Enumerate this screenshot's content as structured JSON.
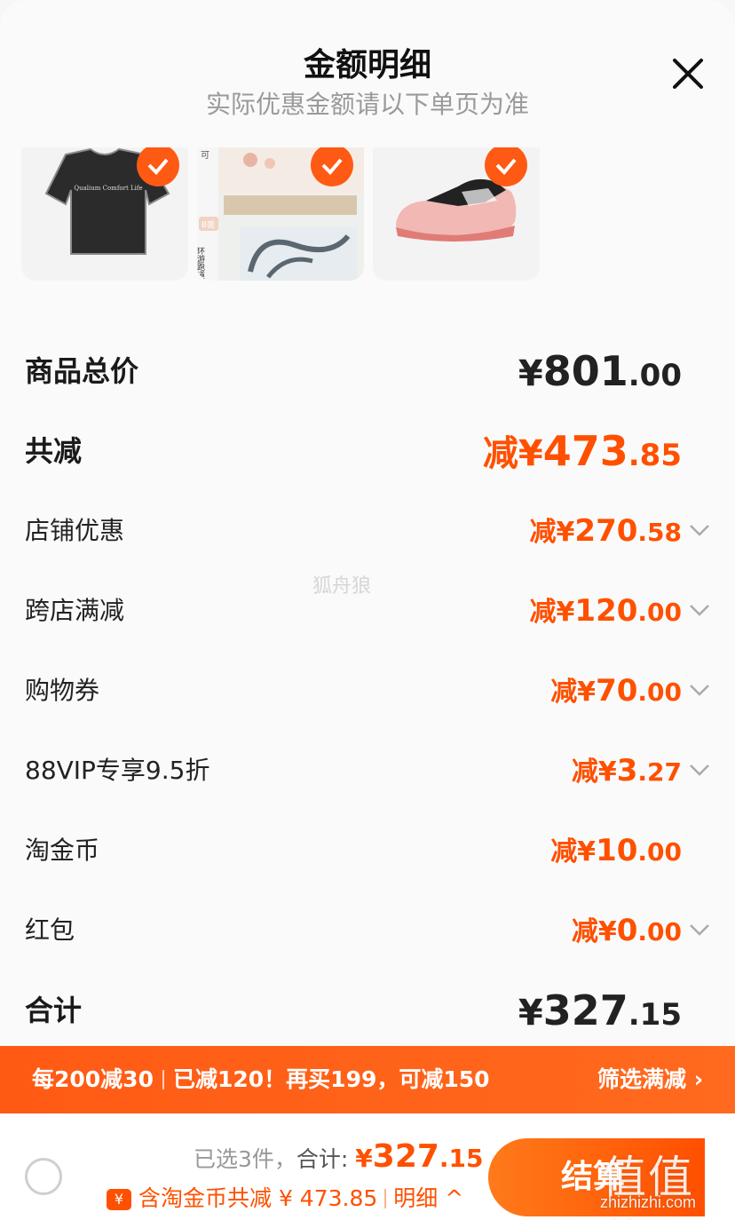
{
  "header": {
    "title": "金额明细",
    "subtitle": "实际优惠金额请以下单页为准"
  },
  "products": [
    {
      "name": "black t-shirt",
      "tshirt_text": "Qualium Comfort Life"
    },
    {
      "name": "play mat",
      "labels": [
        "可",
        "B面",
        "环游跑道"
      ]
    },
    {
      "name": "pink sneaker"
    }
  ],
  "summary": {
    "goods_total": {
      "label": "商品总价",
      "prefix": "¥",
      "int": "801",
      "dec": ".00"
    },
    "total_discount": {
      "label": "共减",
      "prefix": "减¥",
      "int": "473",
      "dec": ".85"
    },
    "items": [
      {
        "label": "店铺优惠",
        "prefix": "减¥",
        "int": "270",
        "dec": ".58",
        "expandable": true
      },
      {
        "label": "跨店满减",
        "prefix": "减¥",
        "int": "120",
        "dec": ".00",
        "expandable": true
      },
      {
        "label": "购物券",
        "prefix": "减¥",
        "int": "70",
        "dec": ".00",
        "expandable": true
      },
      {
        "label": "88VIP专享9.5折",
        "prefix": "减¥",
        "int": "3",
        "dec": ".27",
        "expandable": true
      },
      {
        "label": "淘金币",
        "prefix": "减¥",
        "int": "10",
        "dec": ".00",
        "expandable": false
      },
      {
        "label": "红包",
        "prefix": "减¥",
        "int": "0",
        "dec": ".00",
        "expandable": true
      }
    ],
    "final_total": {
      "label": "合计",
      "prefix": "¥",
      "int": "327",
      "dec": ".15"
    }
  },
  "watermark": "狐舟狼",
  "promo_bar": {
    "part1": "每200减30",
    "part2": "已减120！再买199，可减150",
    "filter_label": "筛选满减 ›"
  },
  "checkout_bar": {
    "selected_text": "已选3件，",
    "total_label": "合计: ",
    "total_prefix": "¥",
    "total_int": "327",
    "total_dec": ".15",
    "coin_icon": "¥",
    "coin_text": "含淘金币共减 ¥ 473.85",
    "detail_label": "明细 ^",
    "checkout_label": "结算"
  },
  "branding": {
    "glyphs": "值值值",
    "url": "zhizhizhi.com"
  },
  "colors": {
    "accent": "#ff5000",
    "promo_bar": "#ff5a14"
  }
}
